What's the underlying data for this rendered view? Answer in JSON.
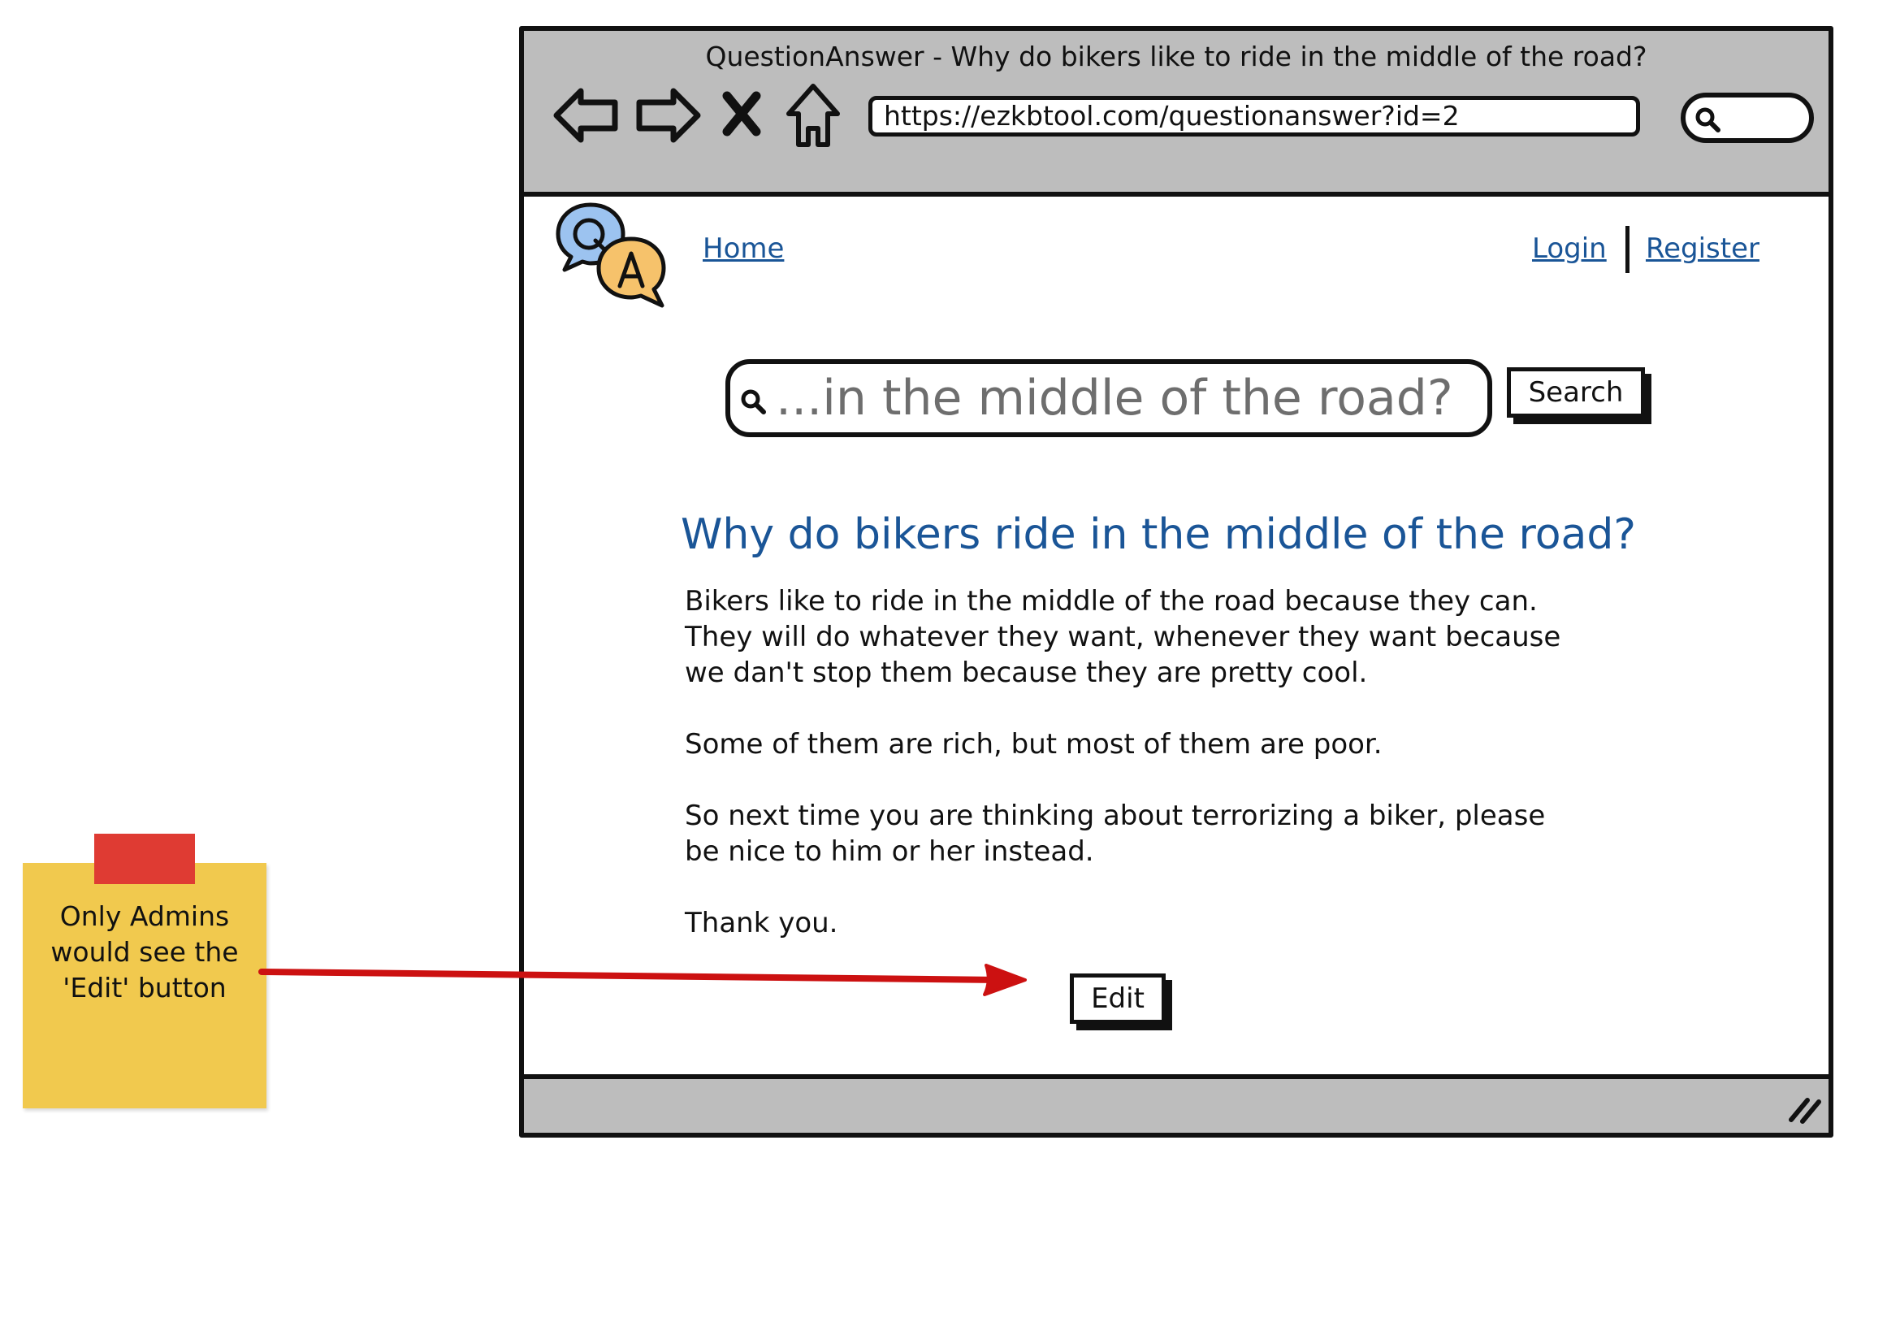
{
  "browser": {
    "title": "QuestionAnswer - Why do bikers like to ride in the middle of the road?",
    "url": "https://ezkbtool.com/questionanswer?id=2"
  },
  "nav": {
    "home": "Home",
    "login": "Login",
    "register": "Register"
  },
  "search": {
    "query": "...in the middle of the road?",
    "button_label": "Search"
  },
  "answer": {
    "title": "Why do bikers ride in the middle of the road?",
    "paragraphs": [
      "Bikers like to ride in the middle of the road because they can. They will do whatever they want, whenever they want because we dan't stop them because they are pretty cool.",
      "Some of them are rich, but most of them are poor.",
      "So next time you are thinking about terrorizing a biker, please be nice to him or her instead.",
      "Thank you."
    ],
    "edit_label": "Edit"
  },
  "annotation": {
    "note_lines": [
      "Only Admins",
      "would see the",
      "'Edit' button"
    ]
  },
  "icons": {
    "back": "back-arrow-icon",
    "forward": "forward-arrow-icon",
    "stop": "close-icon",
    "home": "home-icon",
    "search": "search-icon",
    "logo": "qa-logo-icon",
    "resize": "resize-grip-icon"
  },
  "colors": {
    "chrome_gray": "#bdbdbd",
    "link_blue": "#1a5597",
    "note_yellow": "#f1c94e",
    "tape_red": "#df3b33",
    "arrow_red": "#cc1111",
    "logo_blue": "#9cc3f0",
    "logo_orange": "#f6c26b"
  }
}
